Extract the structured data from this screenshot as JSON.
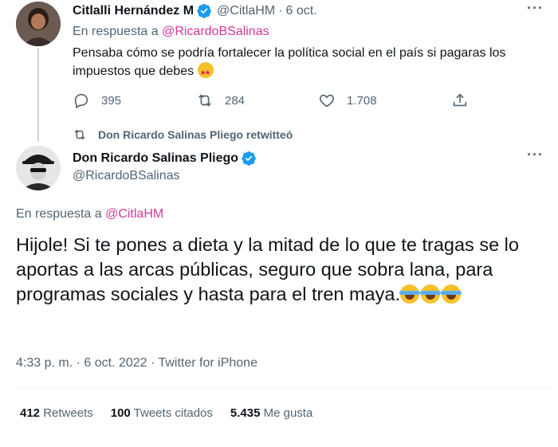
{
  "reply_tweet": {
    "name": "Citlalli Hernández M",
    "handle": "@CitlaHM",
    "separator": "·",
    "date": "6 oct.",
    "reply_prefix": "En respuesta a",
    "reply_to": "@RicardoBSalinas",
    "text": "Pensaba cómo se podría fortalecer la política social en el país si pagaras los impuestos que debes",
    "emoji": "star-struck",
    "replies": "395",
    "retweets": "284",
    "likes": "1.708"
  },
  "retweet_notice": "Don Ricardo Salinas Pliego retwitteó",
  "main_tweet": {
    "name": "Don Ricardo Salinas Pliego",
    "handle": "@RicardoBSalinas",
    "reply_prefix": "En respuesta a",
    "reply_to": "@CitlaHM",
    "text": "Hijole! Si te pones a dieta y la mitad de lo que te tragas se lo aportas a las arcas públicas, seguro que sobra lana, para programas sociales y hasta para el tren maya.",
    "emojis": [
      "tears-of-joy",
      "tears-of-joy",
      "tears-of-joy"
    ],
    "timestamp": "4:33 p. m. · 6 oct. 2022 · Twitter for iPhone",
    "stats": {
      "retweets_count": "412",
      "retweets_label": "Retweets",
      "quotes_count": "100",
      "quotes_label": "Tweets citados",
      "likes_count": "5.435",
      "likes_label": "Me gusta"
    }
  },
  "more_label": "···",
  "colors": {
    "verified": "#1d9bf0",
    "mention": "#d3389a",
    "muted": "#536471"
  }
}
